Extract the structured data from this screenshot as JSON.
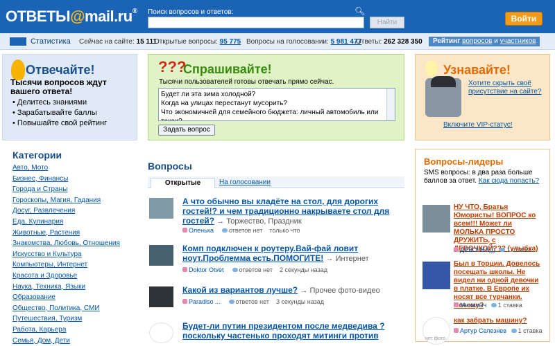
{
  "header": {
    "logo_pre": "ОТВЕТЫ",
    "logo_at": "@",
    "logo_post": "mail.ru",
    "logo_reg": "®",
    "search_label": "Поиск вопросов и ответов:",
    "search_value": "",
    "search_button": "Найти",
    "advanced_search_icon": "zoom-plus-icon",
    "login_button": "Войти",
    "colors": {
      "bar": "#1a63b5",
      "login": "#f39b17"
    }
  },
  "stats": {
    "title": "Статистика",
    "online_label": "Сейчас на сайте:",
    "online_value": "15 111",
    "open_label": "Открытые вопросы:",
    "open_value": "95 775",
    "voting_label": "Вопросы на голосовании:",
    "voting_value": "5 981 477",
    "answers_label": "Ответы:",
    "answers_value": "262 328 350",
    "rating_label": "Рейтинг",
    "rating_questions": "вопросов",
    "rating_and": "и",
    "rating_users": "участников"
  },
  "answer_box": {
    "title": "Отвечайте!",
    "lead": "Тысячи вопросов ждут вашего ответа!",
    "items": [
      "Делитесь знаниями",
      "Зарабатывайте баллы",
      "Повышайте свой рейтинг"
    ]
  },
  "ask_box": {
    "title": "Спрашивайте!",
    "marks": "???",
    "lead": "Тысячи пользователей готовы отвечать прямо сейчас.",
    "examples": [
      "Будет ли эта зима холодной?",
      "Когда на улицах перестанут мусорить?",
      "Что экономичней для семейного бюджета: личный автомобиль или такси?"
    ],
    "button": "Задать вопрос"
  },
  "learn_box": {
    "title": "Узнавайте!",
    "hide_link": "Хотите скрыть своё присутствие на сайте?",
    "vip_link": "Включите VIP-статус!"
  },
  "categories": {
    "title": "Категории",
    "items": [
      "Авто, Мото",
      "Бизнес, Финансы",
      "Города и Страны",
      "Гороскопы, Магия, Гадания",
      "Досуг, Развлечения",
      "Еда, Кулинария",
      "Животные, Растения",
      "Знакомства, Любовь, Отношения",
      "Искусство и Культура",
      "Компьютеры, Интернет",
      "Красота и Здоровье",
      "Наука, Техника, Языки",
      "Образование",
      "Общество, Политика, СМИ",
      "Путешествия, Туризм",
      "Работа, Карьера",
      "Семья, Дом, Дети"
    ]
  },
  "questions": {
    "title": "Вопросы",
    "tabs": [
      "Открытые",
      "На голосовании"
    ],
    "items": [
      {
        "text": "А что обычно вы кладёте на стол, для дорогих гостей!? и чем традиционно накрываете стол для гостей?",
        "category": "Торжество, Праздник",
        "user": "Оленька",
        "answers": "ответов нет",
        "time": "только что"
      },
      {
        "text": "Комп подключен к роутеру.Вай-фай ловит ноут.Проблемма есть.ПОМОГИТЕ!",
        "category": "Интернет",
        "user": "Doktor Otvet",
        "answers": "ответов нет",
        "time": "2 секунды назад"
      },
      {
        "text": "Какой из вариантов лучше?",
        "category": "Прочее фото-видео",
        "user": "Paradiso ...",
        "answers": "ответов нет",
        "time": "3 секунды назад"
      },
      {
        "text": "Будет-ли путин президентом после медведива ? поскольку частенько проходят митинги против",
        "category": "",
        "user": "",
        "answers": "",
        "time": ""
      }
    ]
  },
  "leaders": {
    "title": "Вопросы-лидеры",
    "lead": "SMS вопросы: в два раза больше баллов за ответ.",
    "how_link": "Как сюда попасть?",
    "items": [
      {
        "text": "НУ ЧТО, Братья Юмористы! ВОПРОС ко всем!!! Может ли МОЛЬКА ПРОСТО ДРУЖИТЬ, с ДЕВОЧКОЙ??? (улыбка)",
        "user": "ДЕВОЧКА)))",
        "bet": "1 ставка"
      },
      {
        "text": "Был в Торции. Довелось посещать школы. Не видел ни одной девочки в платке. В Европе их носят все турчанки. Почему?",
        "user": "Михалыч",
        "bet": "1 ставка"
      },
      {
        "text": "как забрать машину?",
        "user": "Артур Селезнев",
        "bet": "1 ставка"
      }
    ],
    "no_photo": "нет фото"
  }
}
